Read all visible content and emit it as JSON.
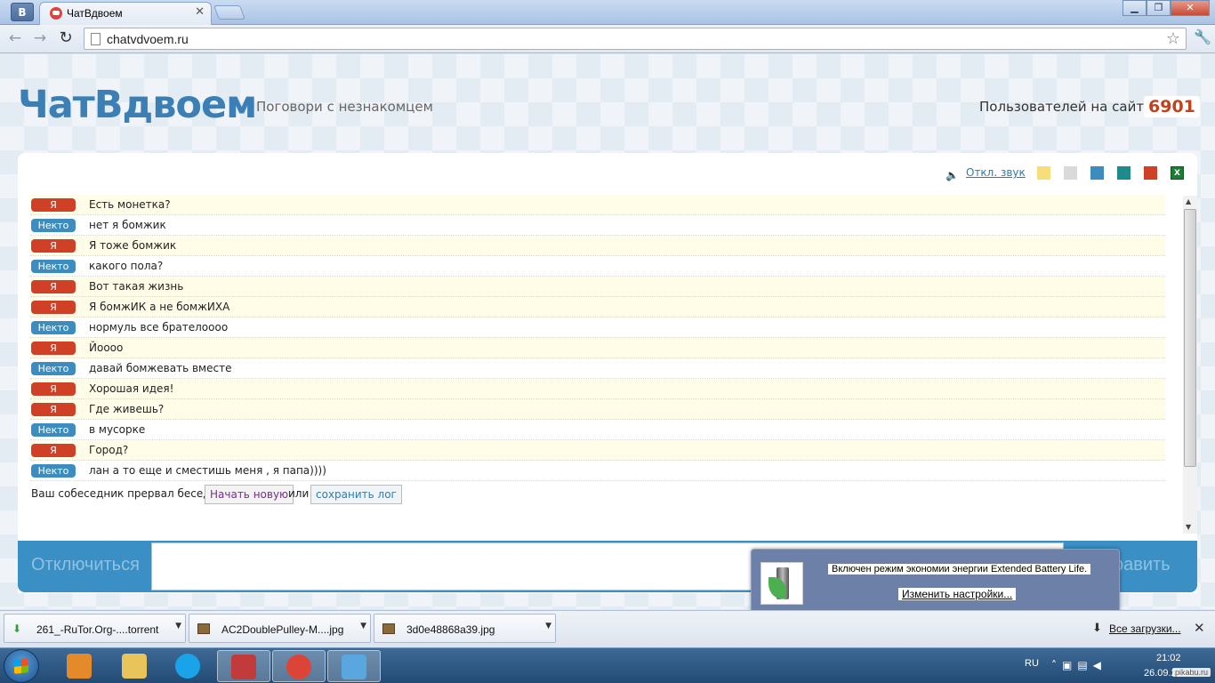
{
  "browser": {
    "app_badge": "B",
    "tab_title": "ЧатВдвоем",
    "url": "chatvdvoem.ru"
  },
  "site": {
    "logo": "ЧатВдвоем",
    "tagline": "Поговори с незнакомцем",
    "users_label": "Пользователей на сайте",
    "users_count": "6901",
    "sound_link": "Откл. звук",
    "theme_colors": [
      "#f7de7a",
      "#dadada",
      "#3d8cc0",
      "#1f8a8a",
      "#d04027"
    ]
  },
  "chat": {
    "messages": [
      {
        "author": "Я",
        "text": "Есть монетка?"
      },
      {
        "author": "Некто",
        "text": "нет я бомжик"
      },
      {
        "author": "Я",
        "text": "Я тоже бомжик"
      },
      {
        "author": "Некто",
        "text": "какого пола?"
      },
      {
        "author": "Я",
        "text": "Вот такая жизнь"
      },
      {
        "author": "Я",
        "text": "Я бомжИК а не бомжИХА"
      },
      {
        "author": "Некто",
        "text": "нормуль все брателоооо"
      },
      {
        "author": "Я",
        "text": "Йоооо"
      },
      {
        "author": "Некто",
        "text": "давай бомжевать вместе"
      },
      {
        "author": "Я",
        "text": "Хорошая идея!"
      },
      {
        "author": "Я",
        "text": "Где живешь?"
      },
      {
        "author": "Некто",
        "text": "в мусорке"
      },
      {
        "author": "Я",
        "text": "Город?"
      },
      {
        "author": "Некто",
        "text": "лан а то еще и сместишь меня , я папа))))"
      }
    ],
    "ended_text": "Ваш собеседник прервал беседу.",
    "new_chat_button": "Начать новую",
    "or_text": "или",
    "save_log_button": "сохранить лог",
    "disconnect_button": "Отключиться",
    "send_button": "равить"
  },
  "notification": {
    "line1": "Включен режим экономии энергии Extended Battery Life.",
    "line2": "Изменить настройки..."
  },
  "downloads": {
    "items": [
      {
        "name": "261_-RuTor.Org-....torrent",
        "icon": "download-arrow-icon"
      },
      {
        "name": "AC2DoublePulley-M....jpg",
        "icon": "image-file-icon"
      },
      {
        "name": "3d0e48868a39.jpg",
        "icon": "image-file-icon"
      }
    ],
    "all_downloads": "Все загрузки..."
  },
  "taskbar": {
    "apps": [
      {
        "name": "media-player-icon",
        "color": "#e58a2a"
      },
      {
        "name": "explorer-icon",
        "color": "#e9c45a"
      },
      {
        "name": "skype-icon",
        "color": "#1aa3e8"
      },
      {
        "name": "flag-app-icon",
        "color": "#c23b3b"
      },
      {
        "name": "chrome-icon",
        "color": "#db4437"
      },
      {
        "name": "music-app-icon",
        "color": "#5aa7e0"
      }
    ],
    "lang": "RU",
    "time": "21:02",
    "date": "26.09.2013",
    "watermark": "pikabu.ru"
  }
}
